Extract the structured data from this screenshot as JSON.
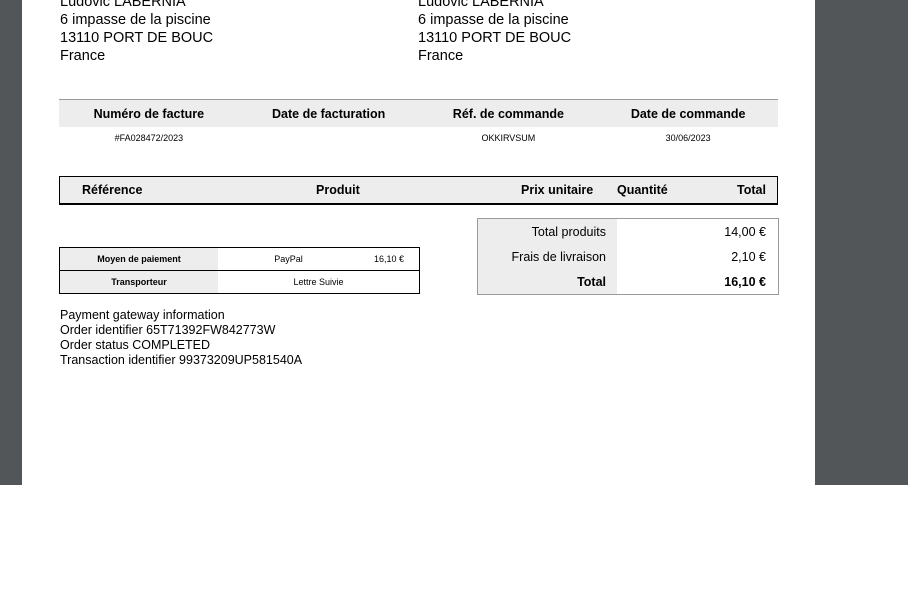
{
  "billing_address": {
    "name": "Ludovic LABERNIA",
    "street": "6 impasse de la piscine",
    "city": "13110 PORT DE BOUC",
    "country": "France"
  },
  "delivery_address": {
    "name": "Ludovic LABERNIA",
    "street": "6 impasse de la piscine",
    "city": "13110 PORT DE BOUC",
    "country": "France"
  },
  "invoice_info": {
    "headers": [
      "Numéro de facture",
      "Date de facturation",
      "Réf. de commande",
      "Date de commande"
    ],
    "values": [
      "#FA028472/2023",
      "",
      "OKKIRVSUM",
      "30/06/2023"
    ]
  },
  "products": {
    "headers": {
      "reference": "Référence",
      "product": "Produit",
      "unit_price": "Prix unitaire",
      "quantity": "Quantité",
      "total": "Total"
    }
  },
  "payment": {
    "method_label": "Moyen de paiement",
    "method_value": "PayPal",
    "method_amount": "16,10 €",
    "carrier_label": "Transporteur",
    "carrier_value": "Lettre Suivie"
  },
  "totals": {
    "products_label": "Total produits",
    "products_value": "14,00 €",
    "shipping_label": "Frais de livraison",
    "shipping_value": "2,10 €",
    "total_label": "Total",
    "total_value": "16,10 €"
  },
  "gateway": {
    "line1": "Payment gateway information",
    "line2": "Order identifier 65T71392FW842773W",
    "line3": "Order status COMPLETED",
    "line4": "Transaction identifier 99373209UP581540A"
  }
}
